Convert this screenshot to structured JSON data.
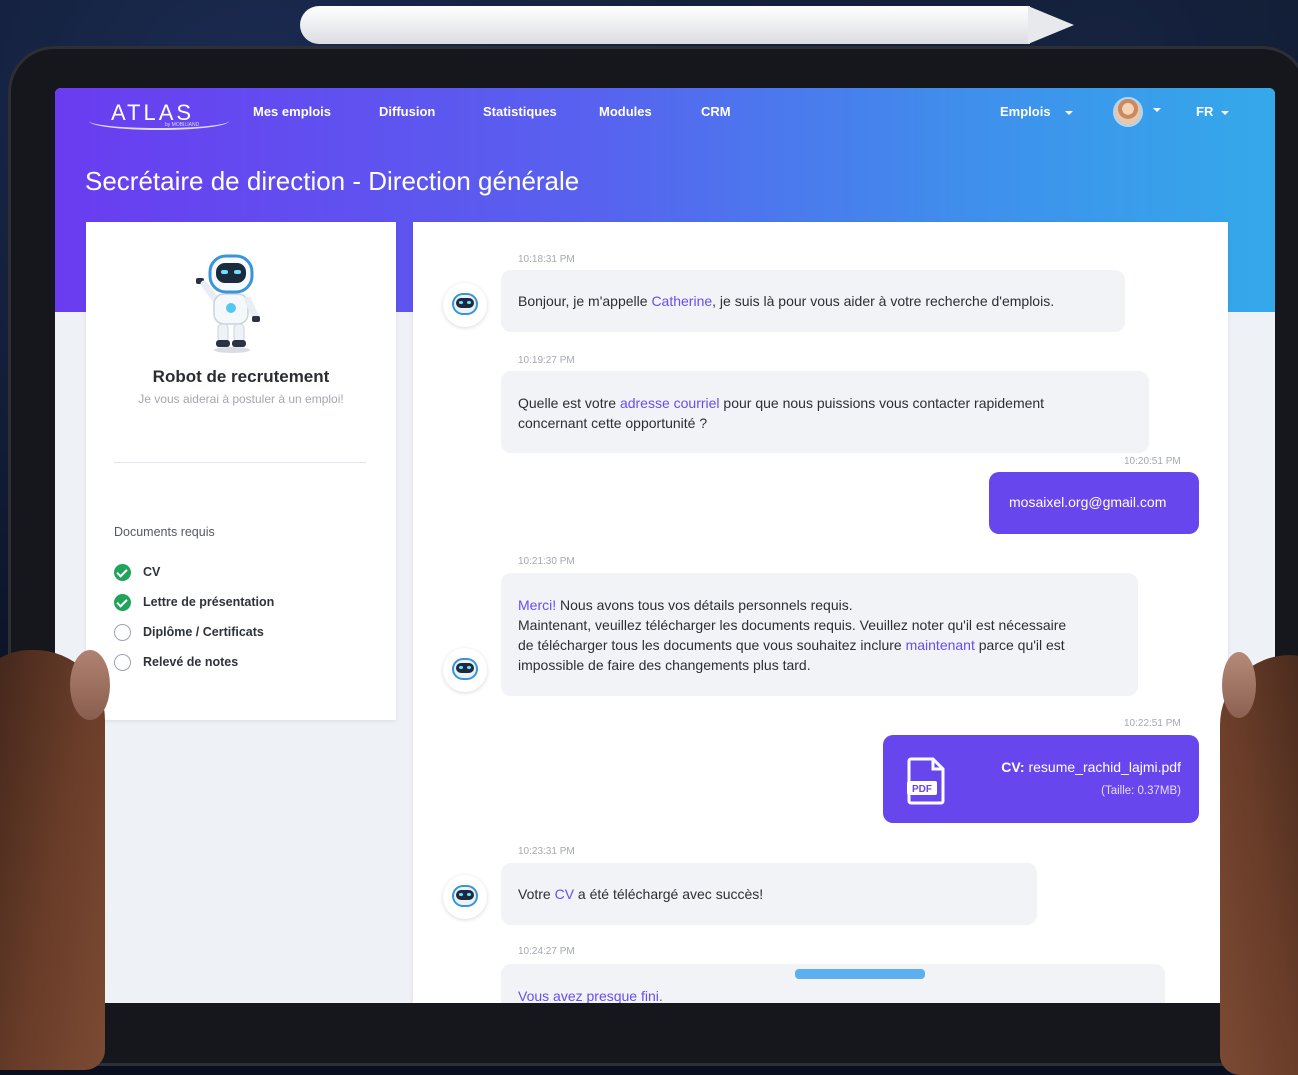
{
  "brand": {
    "logo_text": "ATLAS",
    "logo_sub": "by MOBILIAND"
  },
  "nav": {
    "items": [
      "Mes emplois",
      "Diffusion",
      "Statistiques",
      "Modules",
      "CRM"
    ],
    "emplois_menu": "Emplois",
    "language": "FR"
  },
  "page": {
    "title": "Secrétaire de direction - Direction générale"
  },
  "bot": {
    "name": "Robot de recrutement",
    "tagline": "Je vous aiderai à postuler à un emploi!"
  },
  "documents": {
    "title": "Documents requis",
    "items": [
      {
        "label": "CV",
        "done": true
      },
      {
        "label": "Lettre de présentation",
        "done": true
      },
      {
        "label": "Diplôme / Certificats",
        "done": false
      },
      {
        "label": "Relevé de notes",
        "done": false
      }
    ]
  },
  "chat": {
    "m1": {
      "time": "10:18:31 PM",
      "a": "Bonjour, je m'appelle ",
      "link": "Catherine",
      "b": ", je suis là pour vous aider à votre recherche d'emplois."
    },
    "m2": {
      "time": "10:19:27 PM",
      "a": "Quelle est votre ",
      "link": "adresse courriel",
      "b": " pour que nous puissions vous contacter rapidement",
      "line2": "concernant cette opportunité ?"
    },
    "m3": {
      "time": "10:20:51 PM",
      "text": "mosaixel.org@gmail.com"
    },
    "m4": {
      "time": "10:21:30 PM",
      "link1": "Merci!",
      "a": " Nous avons tous vos détails personnels requis.",
      "line2": "Maintenant, veuillez télécharger les documents requis. Veuillez noter qu'il est nécessaire",
      "line3a": "de télécharger tous les documents que vous souhaitez inclure ",
      "link2": "maintenant",
      "line3b": " parce qu'il est",
      "line4": "impossible de faire des changements plus tard."
    },
    "m5": {
      "time": "10:22:51 PM",
      "file_label": "CV:",
      "file_name": "resume_rachid_lajmi.pdf",
      "file_size": "(Taille: 0.37MB)",
      "icon_text": "PDF"
    },
    "m6": {
      "time": "10:23:31 PM",
      "a": "Votre ",
      "link": "CV",
      "b": " a été téléchargé avec succès!"
    },
    "m7": {
      "time": "10:24:27 PM",
      "text": "Vous avez presque fini."
    }
  },
  "colors": {
    "primary": "#6846ee",
    "gradient_start": "#6a3cf0",
    "gradient_end": "#34a9ea",
    "success": "#20a35a",
    "link": "#6a4cf0"
  }
}
